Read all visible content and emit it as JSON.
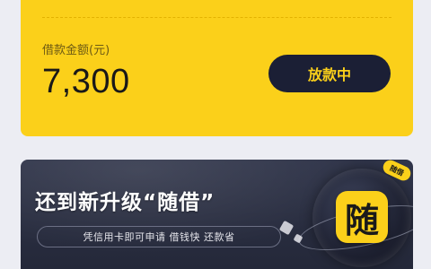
{
  "loan": {
    "amount_label": "借款金额(元)",
    "amount_value": "7,300",
    "status_label": "放款中"
  },
  "banner": {
    "title": "还到新升级“随借”",
    "subtitle": "凭信用卡即可申请 借钱快 还款省",
    "app_icon_glyph": "随",
    "badge_text": "随借"
  },
  "colors": {
    "brand_yellow": "#fbd01a",
    "button_navy": "#1b1f35",
    "banner_dark": "#2a2e42",
    "page_bg": "#ecedf3"
  }
}
